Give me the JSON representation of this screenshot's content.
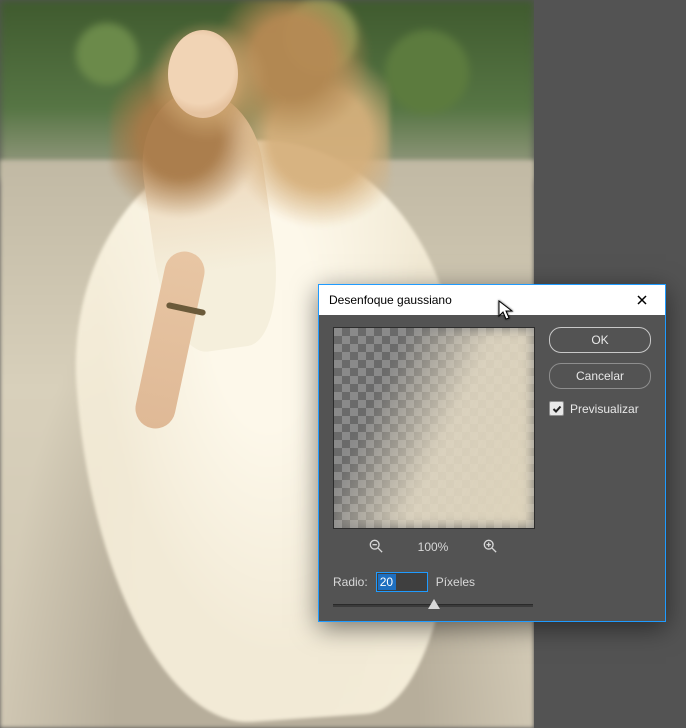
{
  "dialog": {
    "title": "Desenfoque gaussiano",
    "ok_label": "OK",
    "cancel_label": "Cancelar",
    "preview_label": "Previsualizar",
    "preview_checked": true,
    "zoom_value": "100%",
    "radius_label": "Radio:",
    "radius_value": "20",
    "radius_unit": "Píxeles"
  }
}
